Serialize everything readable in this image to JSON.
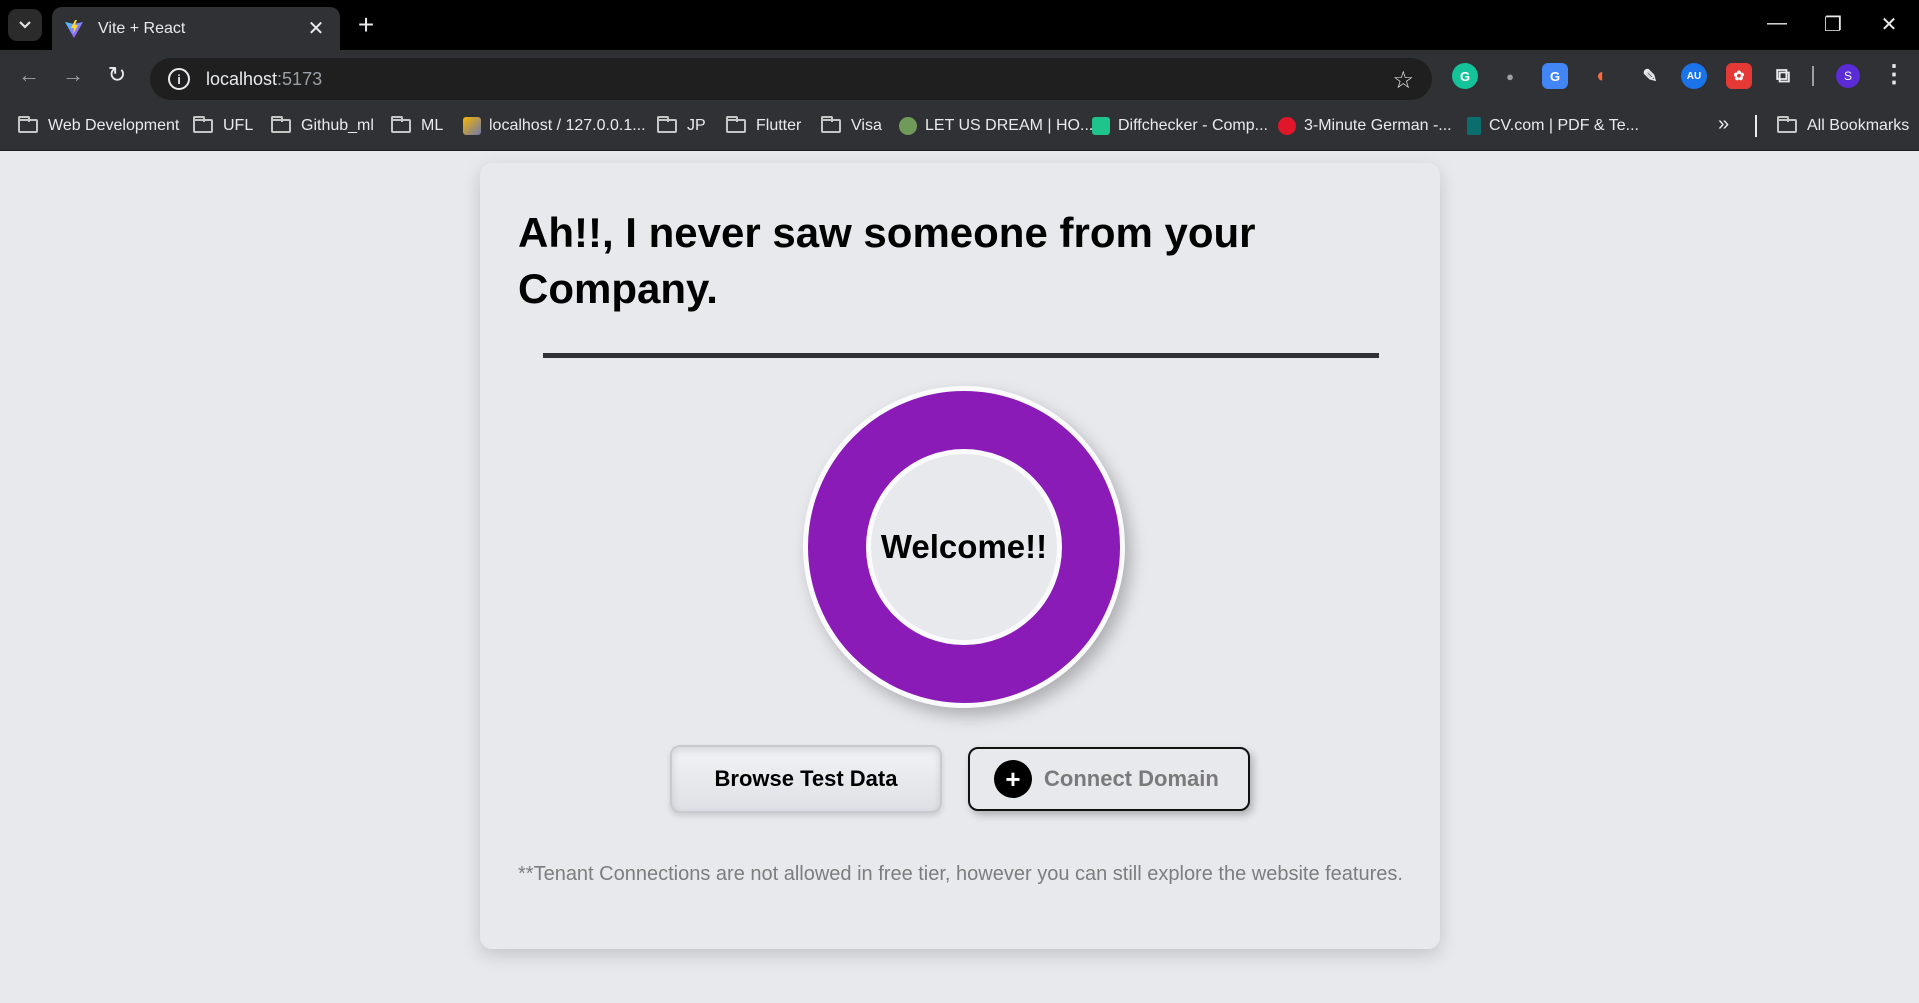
{
  "browser": {
    "tab_title": "Vite + React",
    "url_host": "localhost",
    "url_port": ":5173",
    "bookmarks": [
      {
        "label": "Web Development",
        "type": "folder"
      },
      {
        "label": "UFL",
        "type": "folder"
      },
      {
        "label": "Github_ml",
        "type": "folder"
      },
      {
        "label": "ML",
        "type": "folder"
      },
      {
        "label": "localhost / 127.0.0.1...",
        "type": "site"
      },
      {
        "label": "JP",
        "type": "folder"
      },
      {
        "label": "Flutter",
        "type": "folder"
      },
      {
        "label": "Visa",
        "type": "folder"
      },
      {
        "label": "LET US DREAM | HO...",
        "type": "site"
      },
      {
        "label": "Diffchecker - Comp...",
        "type": "site"
      },
      {
        "label": "3-Minute German -...",
        "type": "site"
      },
      {
        "label": "CV.com | PDF & Te...",
        "type": "site"
      }
    ],
    "all_bookmarks_label": "All Bookmarks",
    "profile_initial": "S",
    "extension_badge": "AU"
  },
  "main": {
    "headline": "Ah!!, I never saw someone from your Company.",
    "welcome": "Welcome!!",
    "browse_button": "Browse Test Data",
    "connect_button": "Connect Domain",
    "note": "**Tenant Connections are not allowed in free tier, however you can still explore the website features."
  },
  "colors": {
    "accent_purple": "#8a1bb6",
    "background": "#e8e9ed",
    "chrome_dark": "#303134"
  }
}
